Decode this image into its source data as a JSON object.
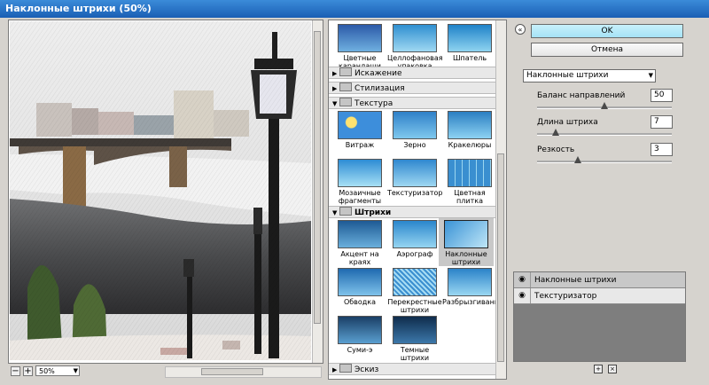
{
  "window": {
    "title": "Наклонные штрихи (50%)"
  },
  "preview": {
    "zoom": "50%",
    "zoom_minus": "−",
    "zoom_plus": "+"
  },
  "gallery": {
    "top_items": [
      {
        "label": "Цветные карандаши"
      },
      {
        "label": "Целлофановая упаковка"
      },
      {
        "label": "Шпатель"
      }
    ],
    "categories": [
      {
        "label": "Искажение",
        "open": false
      },
      {
        "label": "Стилизация",
        "open": false
      },
      {
        "label": "Текстура",
        "open": true
      },
      {
        "label": "Штрихи",
        "open": true
      },
      {
        "label": "Эскиз",
        "open": false
      }
    ],
    "texture_items": [
      {
        "label": "Витраж"
      },
      {
        "label": "Зерно"
      },
      {
        "label": "Кракелюры"
      },
      {
        "label": "Мозаичные фрагменты"
      },
      {
        "label": "Текстуризатор"
      },
      {
        "label": "Цветная плитка"
      }
    ],
    "strokes_items": [
      {
        "label": "Акцент на краях"
      },
      {
        "label": "Аэрограф"
      },
      {
        "label": "Наклонные штрихи",
        "selected": true
      },
      {
        "label": "Обводка"
      },
      {
        "label": "Перекрестные штрихи"
      },
      {
        "label": "Разбрызгивание"
      },
      {
        "label": "Суми-э"
      },
      {
        "label": "Темные штрихи"
      }
    ]
  },
  "buttons": {
    "ok": "OK",
    "cancel": "Отмена",
    "collapse": "«"
  },
  "filter_select": {
    "value": "Наклонные штрихи"
  },
  "params": [
    {
      "label": "Баланс направлений",
      "value": "50",
      "fraction": 0.5
    },
    {
      "label": "Длина штриха",
      "value": "7",
      "fraction": 0.14
    },
    {
      "label": "Резкость",
      "value": "3",
      "fraction": 0.3
    }
  ],
  "layers": [
    {
      "label": "Наклонные штрихи",
      "selected": true
    },
    {
      "label": "Текстуризатор",
      "selected": false
    }
  ],
  "icons": {
    "eye": "eye-icon",
    "new_layer": "new-layer-icon",
    "delete": "trash-icon"
  }
}
